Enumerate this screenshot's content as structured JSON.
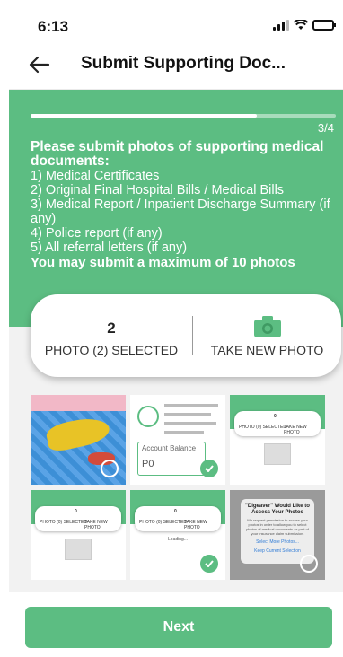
{
  "status_bar": {
    "time": "6:13"
  },
  "header": {
    "title": "Submit Supporting Doc..."
  },
  "progress": {
    "fraction": 0.74,
    "step_label": "3/4"
  },
  "instructions": {
    "lead": "Please submit photos of supporting medical documents:",
    "items": [
      "1) Medical Certificates",
      "2) Original Final Hospital Bills / Medical Bills",
      "3) Medical Report / Inpatient Discharge Summary (if any)",
      "4) Police report (if any)",
      "5) All referral letters (if any)"
    ],
    "tail": "You may submit a maximum of 10 photos"
  },
  "photo_card": {
    "count": "2",
    "selected_label": "PHOTO (2) SELECTED",
    "take_label": "TAKE NEW PHOTO"
  },
  "thumbnails": {
    "profile": {
      "account_label": "Account Balance",
      "account_value": "P0"
    },
    "mini_app": {
      "count": "0",
      "selected": "PHOTO (0) SELECTED",
      "take": "TAKE NEW PHOTO",
      "loading": "Loading..."
    },
    "dialog": {
      "title": "\"Digeaver\" Would Like to Access Your Photos",
      "body": "We request permission to access your photos in order to allow you to select photos of medical documents as part of your insurance claim submission.",
      "option1": "Select More Photos...",
      "option2": "Keep Current Selection"
    }
  },
  "selection": [
    false,
    true,
    false,
    false,
    true,
    false
  ],
  "footer": {
    "next_label": "Next"
  },
  "colors": {
    "accent": "#5cbd82"
  }
}
